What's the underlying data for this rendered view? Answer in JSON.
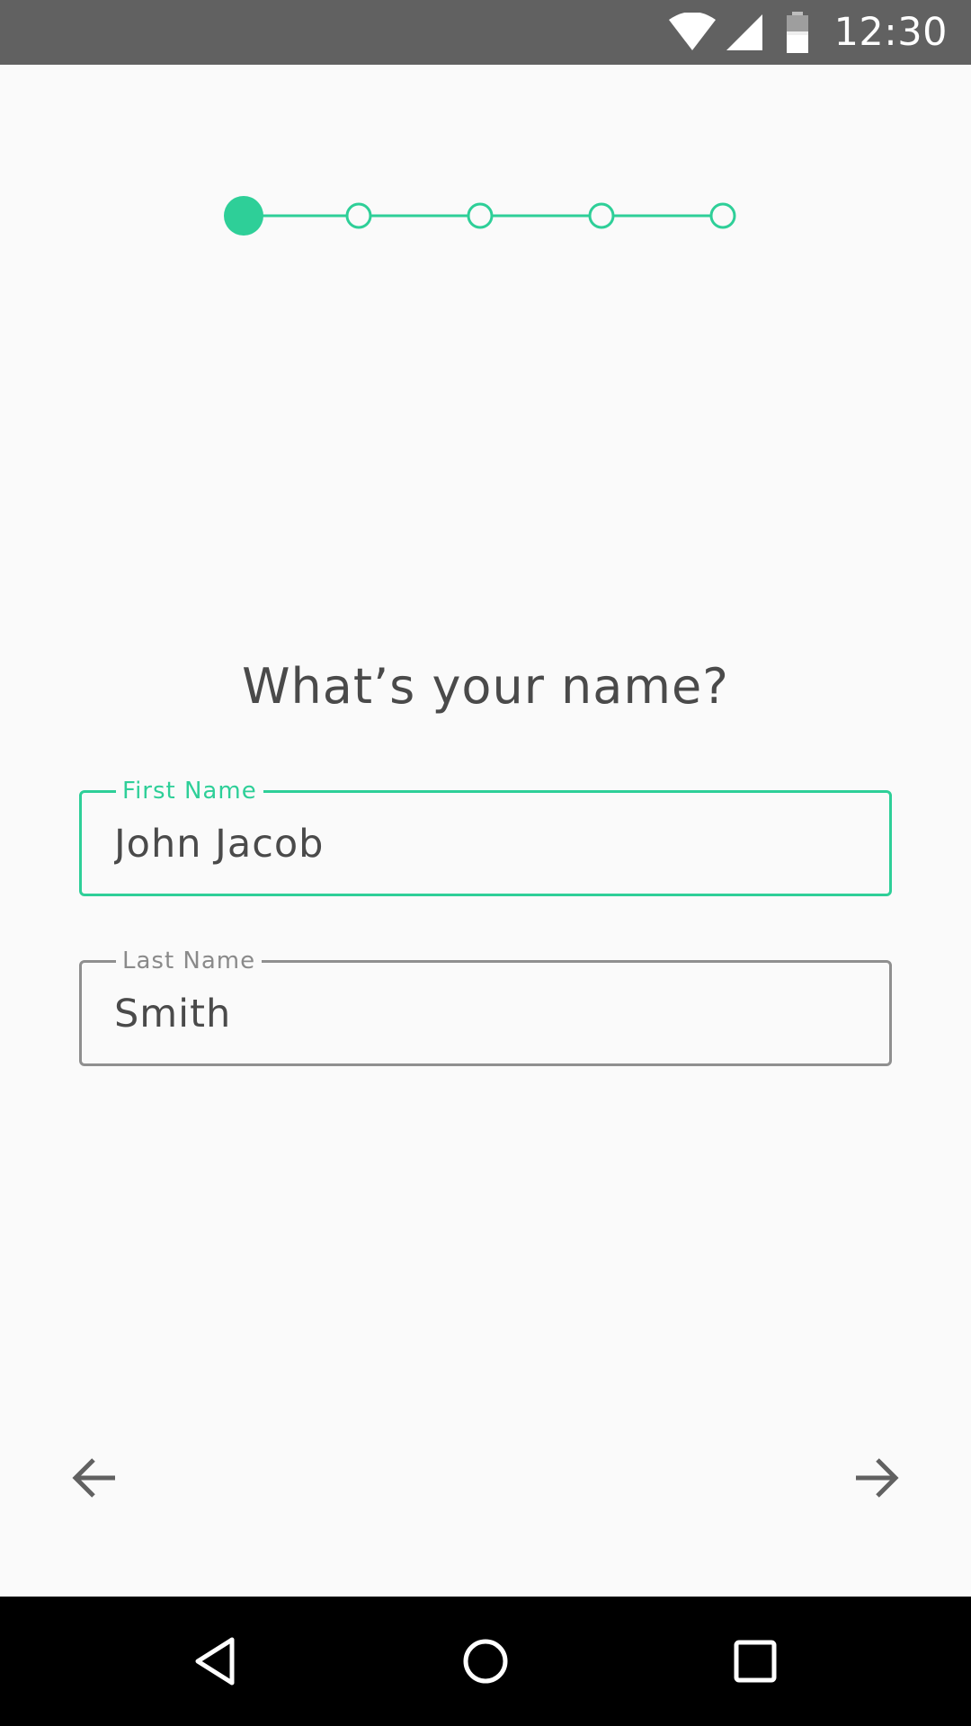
{
  "status_bar": {
    "time": "12:30",
    "icons": [
      "wifi-icon",
      "cell-signal-icon",
      "battery-icon"
    ]
  },
  "stepper": {
    "total_steps": 5,
    "current_step": 1,
    "accent_color": "#2ecf98"
  },
  "form": {
    "title": "What’s your name?",
    "first_name": {
      "label": "First Name",
      "value": "John Jacob",
      "state": "focused"
    },
    "last_name": {
      "label": "Last Name",
      "value": "Smith",
      "state": "inactive"
    }
  },
  "navigation": {
    "back_icon": "arrow-left-icon",
    "next_icon": "arrow-right-icon"
  },
  "system_nav": {
    "icons": [
      "back-triangle-icon",
      "home-circle-icon",
      "recents-square-icon"
    ]
  },
  "colors": {
    "accent": "#2ecf98",
    "status_bar": "#616161",
    "background": "#fafafa",
    "text": "#4a4a4a",
    "inactive_border": "#8f8f8f",
    "system_nav": "#000000"
  }
}
